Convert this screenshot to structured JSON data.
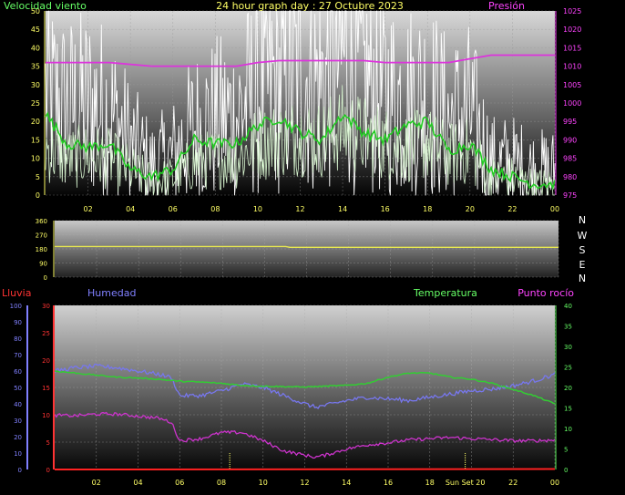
{
  "title": "24 hour graph day : 27 Octubre 2023",
  "colors": {
    "wind_gust": "#ffffff",
    "wind_speed": "#d8f5d0",
    "wind_avg": "#22cc22",
    "pressure": "#dd33dd",
    "direction": "#e8e850",
    "humidity": "#7777ee",
    "temperature": "#33cc33",
    "dewpoint": "#cc33cc",
    "rain": "#ff2222",
    "axis_yellow": "#ffff66",
    "label_lime": "#66ff66",
    "label_blue": "#8080ff",
    "label_magenta": "#ff44ff",
    "label_red": "#ff3333"
  },
  "x_ticks": [
    "02",
    "04",
    "06",
    "08",
    "10",
    "12",
    "14",
    "16",
    "18",
    "20",
    "22",
    "00"
  ],
  "chart_data": [
    {
      "type": "line",
      "name": "wind",
      "labels": {
        "left": "Velocidad viento",
        "right": "Presión"
      },
      "x_range_hours": [
        0,
        24
      ],
      "ylim_left": [
        0,
        50
      ],
      "left_ticks": [
        "0",
        "5",
        "10",
        "15",
        "20",
        "25",
        "30",
        "35",
        "40",
        "45",
        "50"
      ],
      "ylim_right": [
        975,
        1025
      ],
      "right_ticks": [
        "975",
        "980",
        "985",
        "990",
        "995",
        "1000",
        "1005",
        "1010",
        "1015",
        "1020",
        "1025"
      ],
      "series": [
        {
          "key": "gust",
          "axis": "left",
          "x": [
            0,
            1,
            2,
            3,
            4,
            5,
            6,
            7,
            8,
            9,
            10,
            11,
            12,
            13,
            14,
            15,
            16,
            17,
            18,
            19,
            20,
            21,
            22,
            23,
            24
          ],
          "values": [
            24,
            21,
            22,
            20,
            12,
            6,
            9,
            16,
            18,
            19,
            26,
            27,
            30,
            27,
            34,
            28,
            24,
            23,
            24,
            18,
            20,
            7,
            7,
            5,
            5
          ]
        },
        {
          "key": "speed",
          "axis": "left",
          "x": [
            0,
            1,
            2,
            3,
            4,
            5,
            6,
            7,
            8,
            9,
            10,
            11,
            12,
            13,
            14,
            15,
            16,
            17,
            18,
            19,
            20,
            21,
            22,
            23,
            24
          ],
          "values": [
            12,
            9,
            10,
            9,
            6,
            3,
            4,
            8,
            9,
            9,
            13,
            14,
            15,
            14,
            17,
            15,
            13,
            12,
            13,
            10,
            11,
            4,
            4,
            2,
            2
          ]
        },
        {
          "key": "avg",
          "axis": "left",
          "x": [
            0,
            1,
            2,
            3,
            4,
            5,
            6,
            7,
            8,
            9,
            10,
            11,
            12,
            13,
            14,
            15,
            16,
            17,
            18,
            19,
            20,
            21,
            22,
            23,
            24
          ],
          "values": [
            22,
            14,
            13,
            14,
            7,
            5,
            7,
            15,
            14,
            14,
            19,
            21,
            17,
            15,
            22,
            17,
            15,
            19,
            20,
            12,
            14,
            7,
            5,
            3,
            3
          ]
        },
        {
          "key": "pressure",
          "axis": "right",
          "x": [
            0,
            1,
            2,
            3,
            4,
            5,
            6,
            7,
            8,
            9,
            10,
            11,
            12,
            13,
            14,
            15,
            16,
            17,
            18,
            19,
            20,
            21,
            22,
            23,
            24
          ],
          "values": [
            1011,
            1011,
            1011,
            1011,
            1010.5,
            1010,
            1010,
            1010,
            1010,
            1010,
            1011,
            1011.5,
            1011.5,
            1011.5,
            1011.5,
            1011.5,
            1011,
            1011,
            1011,
            1011,
            1012,
            1013,
            1013,
            1013,
            1013
          ]
        }
      ]
    },
    {
      "type": "line",
      "name": "direction",
      "labels": {
        "compass": [
          "N",
          "W",
          "S",
          "E",
          "N"
        ]
      },
      "x_range_hours": [
        0,
        24
      ],
      "ylim": [
        0,
        360
      ],
      "left_ticks": [
        "0",
        "90",
        "180",
        "270",
        "360"
      ],
      "series": [
        {
          "key": "direction",
          "x": [
            0,
            11,
            11.2,
            24
          ],
          "values": [
            195,
            195,
            190,
            190
          ]
        }
      ]
    },
    {
      "type": "line",
      "name": "temp_hum",
      "labels": {
        "rain": "Lluvia",
        "humidity": "Humedad",
        "temperature": "Temperatura",
        "dewpoint": "Punto rocío",
        "sunset": "Sun Set 20"
      },
      "x_range_hours": [
        0,
        24
      ],
      "rain_ylim": [
        0,
        30
      ],
      "rain_ticks": [
        "0",
        "5",
        "10",
        "15",
        "20",
        "25",
        "30"
      ],
      "humidity_ylim": [
        0,
        100
      ],
      "humidity_ticks": [
        "0",
        "10",
        "20",
        "30",
        "40",
        "50",
        "60",
        "70",
        "80",
        "90",
        "100"
      ],
      "temp_ylim": [
        0,
        40
      ],
      "temp_ticks": [
        "0",
        "5",
        "10",
        "15",
        "20",
        "25",
        "30",
        "35",
        "40"
      ],
      "markers_hours": [
        8.4,
        19.7
      ],
      "series": [
        {
          "key": "humidity",
          "axis": "humidity",
          "x": [
            0,
            1,
            2,
            3,
            4,
            5,
            5.6,
            6,
            7,
            8,
            9,
            10,
            11,
            12,
            12.5,
            13,
            14,
            15,
            16,
            17,
            18,
            19,
            20,
            21,
            22,
            23,
            24
          ],
          "values": [
            60,
            62,
            63,
            62,
            60,
            58,
            56,
            45,
            45,
            48,
            52,
            50,
            45,
            40,
            38,
            39,
            42,
            44,
            43,
            42,
            44,
            46,
            48,
            49,
            51,
            54,
            58
          ]
        },
        {
          "key": "temperature",
          "axis": "temp",
          "x": [
            0,
            1,
            2,
            3,
            4,
            5,
            6,
            7,
            8,
            9,
            10,
            11,
            12,
            13,
            14,
            15,
            16,
            17,
            18,
            19,
            20,
            21,
            22,
            23,
            24
          ],
          "values": [
            24,
            23.5,
            23,
            22.5,
            22.3,
            22,
            21.5,
            21.3,
            21,
            20.5,
            20.3,
            20.2,
            20.1,
            20.3,
            20.5,
            21,
            22.5,
            23.5,
            23.5,
            22.5,
            22,
            21,
            19.5,
            18,
            16
          ]
        },
        {
          "key": "dewpoint",
          "axis": "temp",
          "x": [
            0,
            1,
            2,
            3,
            4,
            5,
            5.6,
            6,
            7,
            8,
            9,
            10,
            11,
            12,
            12.5,
            13,
            14,
            15,
            16,
            17,
            18,
            19,
            20,
            21,
            22,
            23,
            24
          ],
          "values": [
            13.2,
            13.1,
            13.5,
            13.5,
            13,
            12.5,
            11.5,
            7,
            7.5,
            9,
            9,
            7,
            4.5,
            3.5,
            3,
            3.5,
            5,
            6,
            6.5,
            7.2,
            7.5,
            7.8,
            7.5,
            7.3,
            7,
            7,
            7.2
          ]
        },
        {
          "key": "rain",
          "axis": "rain",
          "x": [
            0,
            24
          ],
          "values": [
            0,
            0
          ]
        }
      ]
    }
  ]
}
